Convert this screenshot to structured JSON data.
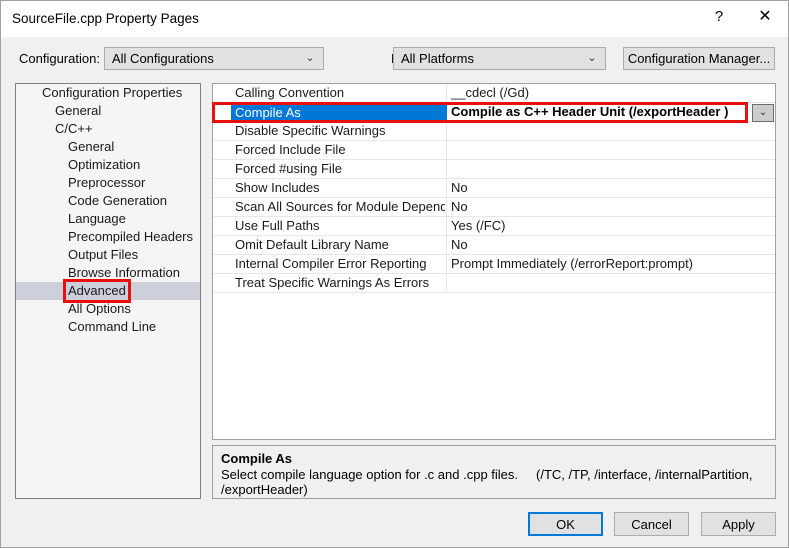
{
  "window": {
    "title": "SourceFile.cpp Property Pages",
    "help_glyph": "?",
    "close_glyph": "✕"
  },
  "toolbar": {
    "configuration_label": "Configuration:",
    "configuration_value": "All Configurations",
    "platform_label": "Platform:",
    "platform_value": "All Platforms",
    "configuration_manager_label": "Configuration Manager...",
    "chevron": "⌄"
  },
  "tree": {
    "items": [
      {
        "label": "Configuration Properties",
        "depth": 0,
        "expander": "◢",
        "selected": false,
        "annotated": false
      },
      {
        "label": "General",
        "depth": 1,
        "expander": "",
        "selected": false,
        "annotated": false
      },
      {
        "label": "C/C++",
        "depth": 1,
        "expander": "◢",
        "selected": false,
        "annotated": false
      },
      {
        "label": "General",
        "depth": 2,
        "expander": "",
        "selected": false,
        "annotated": false
      },
      {
        "label": "Optimization",
        "depth": 2,
        "expander": "",
        "selected": false,
        "annotated": false
      },
      {
        "label": "Preprocessor",
        "depth": 2,
        "expander": "",
        "selected": false,
        "annotated": false
      },
      {
        "label": "Code Generation",
        "depth": 2,
        "expander": "",
        "selected": false,
        "annotated": false
      },
      {
        "label": "Language",
        "depth": 2,
        "expander": "",
        "selected": false,
        "annotated": false
      },
      {
        "label": "Precompiled Headers",
        "depth": 2,
        "expander": "",
        "selected": false,
        "annotated": false
      },
      {
        "label": "Output Files",
        "depth": 2,
        "expander": "",
        "selected": false,
        "annotated": false
      },
      {
        "label": "Browse Information",
        "depth": 2,
        "expander": "",
        "selected": false,
        "annotated": false
      },
      {
        "label": "Advanced",
        "depth": 2,
        "expander": "",
        "selected": true,
        "annotated": true
      },
      {
        "label": "All Options",
        "depth": 2,
        "expander": "",
        "selected": false,
        "annotated": false
      },
      {
        "label": "Command Line",
        "depth": 2,
        "expander": "",
        "selected": false,
        "annotated": false
      }
    ]
  },
  "grid": {
    "rows": [
      {
        "name": "Calling Convention",
        "value": "__cdecl (/Gd)",
        "selected": false
      },
      {
        "name": "Compile As",
        "value": "Compile as C++ Header Unit (/exportHeader )",
        "selected": true
      },
      {
        "name": "Disable Specific Warnings",
        "value": "",
        "selected": false
      },
      {
        "name": "Forced Include File",
        "value": "",
        "selected": false
      },
      {
        "name": "Forced #using File",
        "value": "",
        "selected": false
      },
      {
        "name": "Show Includes",
        "value": "No",
        "selected": false
      },
      {
        "name": "Scan All Sources for Module Dependeni",
        "value": "No",
        "selected": false
      },
      {
        "name": "Use Full Paths",
        "value": "Yes (/FC)",
        "selected": false
      },
      {
        "name": "Omit Default Library Name",
        "value": "No",
        "selected": false
      },
      {
        "name": "Internal Compiler Error Reporting",
        "value": "Prompt Immediately (/errorReport:prompt)",
        "selected": false
      },
      {
        "name": "Treat Specific Warnings As Errors",
        "value": "",
        "selected": false
      }
    ],
    "dropdown_chevron": "⌄"
  },
  "description": {
    "title": "Compile As",
    "text": "Select compile language option for .c and .cpp files.",
    "switches": "(/TC, /TP, /interface, /internalPartition, /exportHeader)"
  },
  "footer": {
    "ok_label": "OK",
    "cancel_label": "Cancel",
    "apply_label": "Apply"
  },
  "colors": {
    "selection_blue": "#0078d7",
    "annotation_red": "#e8100f",
    "tree_selection": "#cdcfdb",
    "window_bg": "#f0f0f0"
  }
}
